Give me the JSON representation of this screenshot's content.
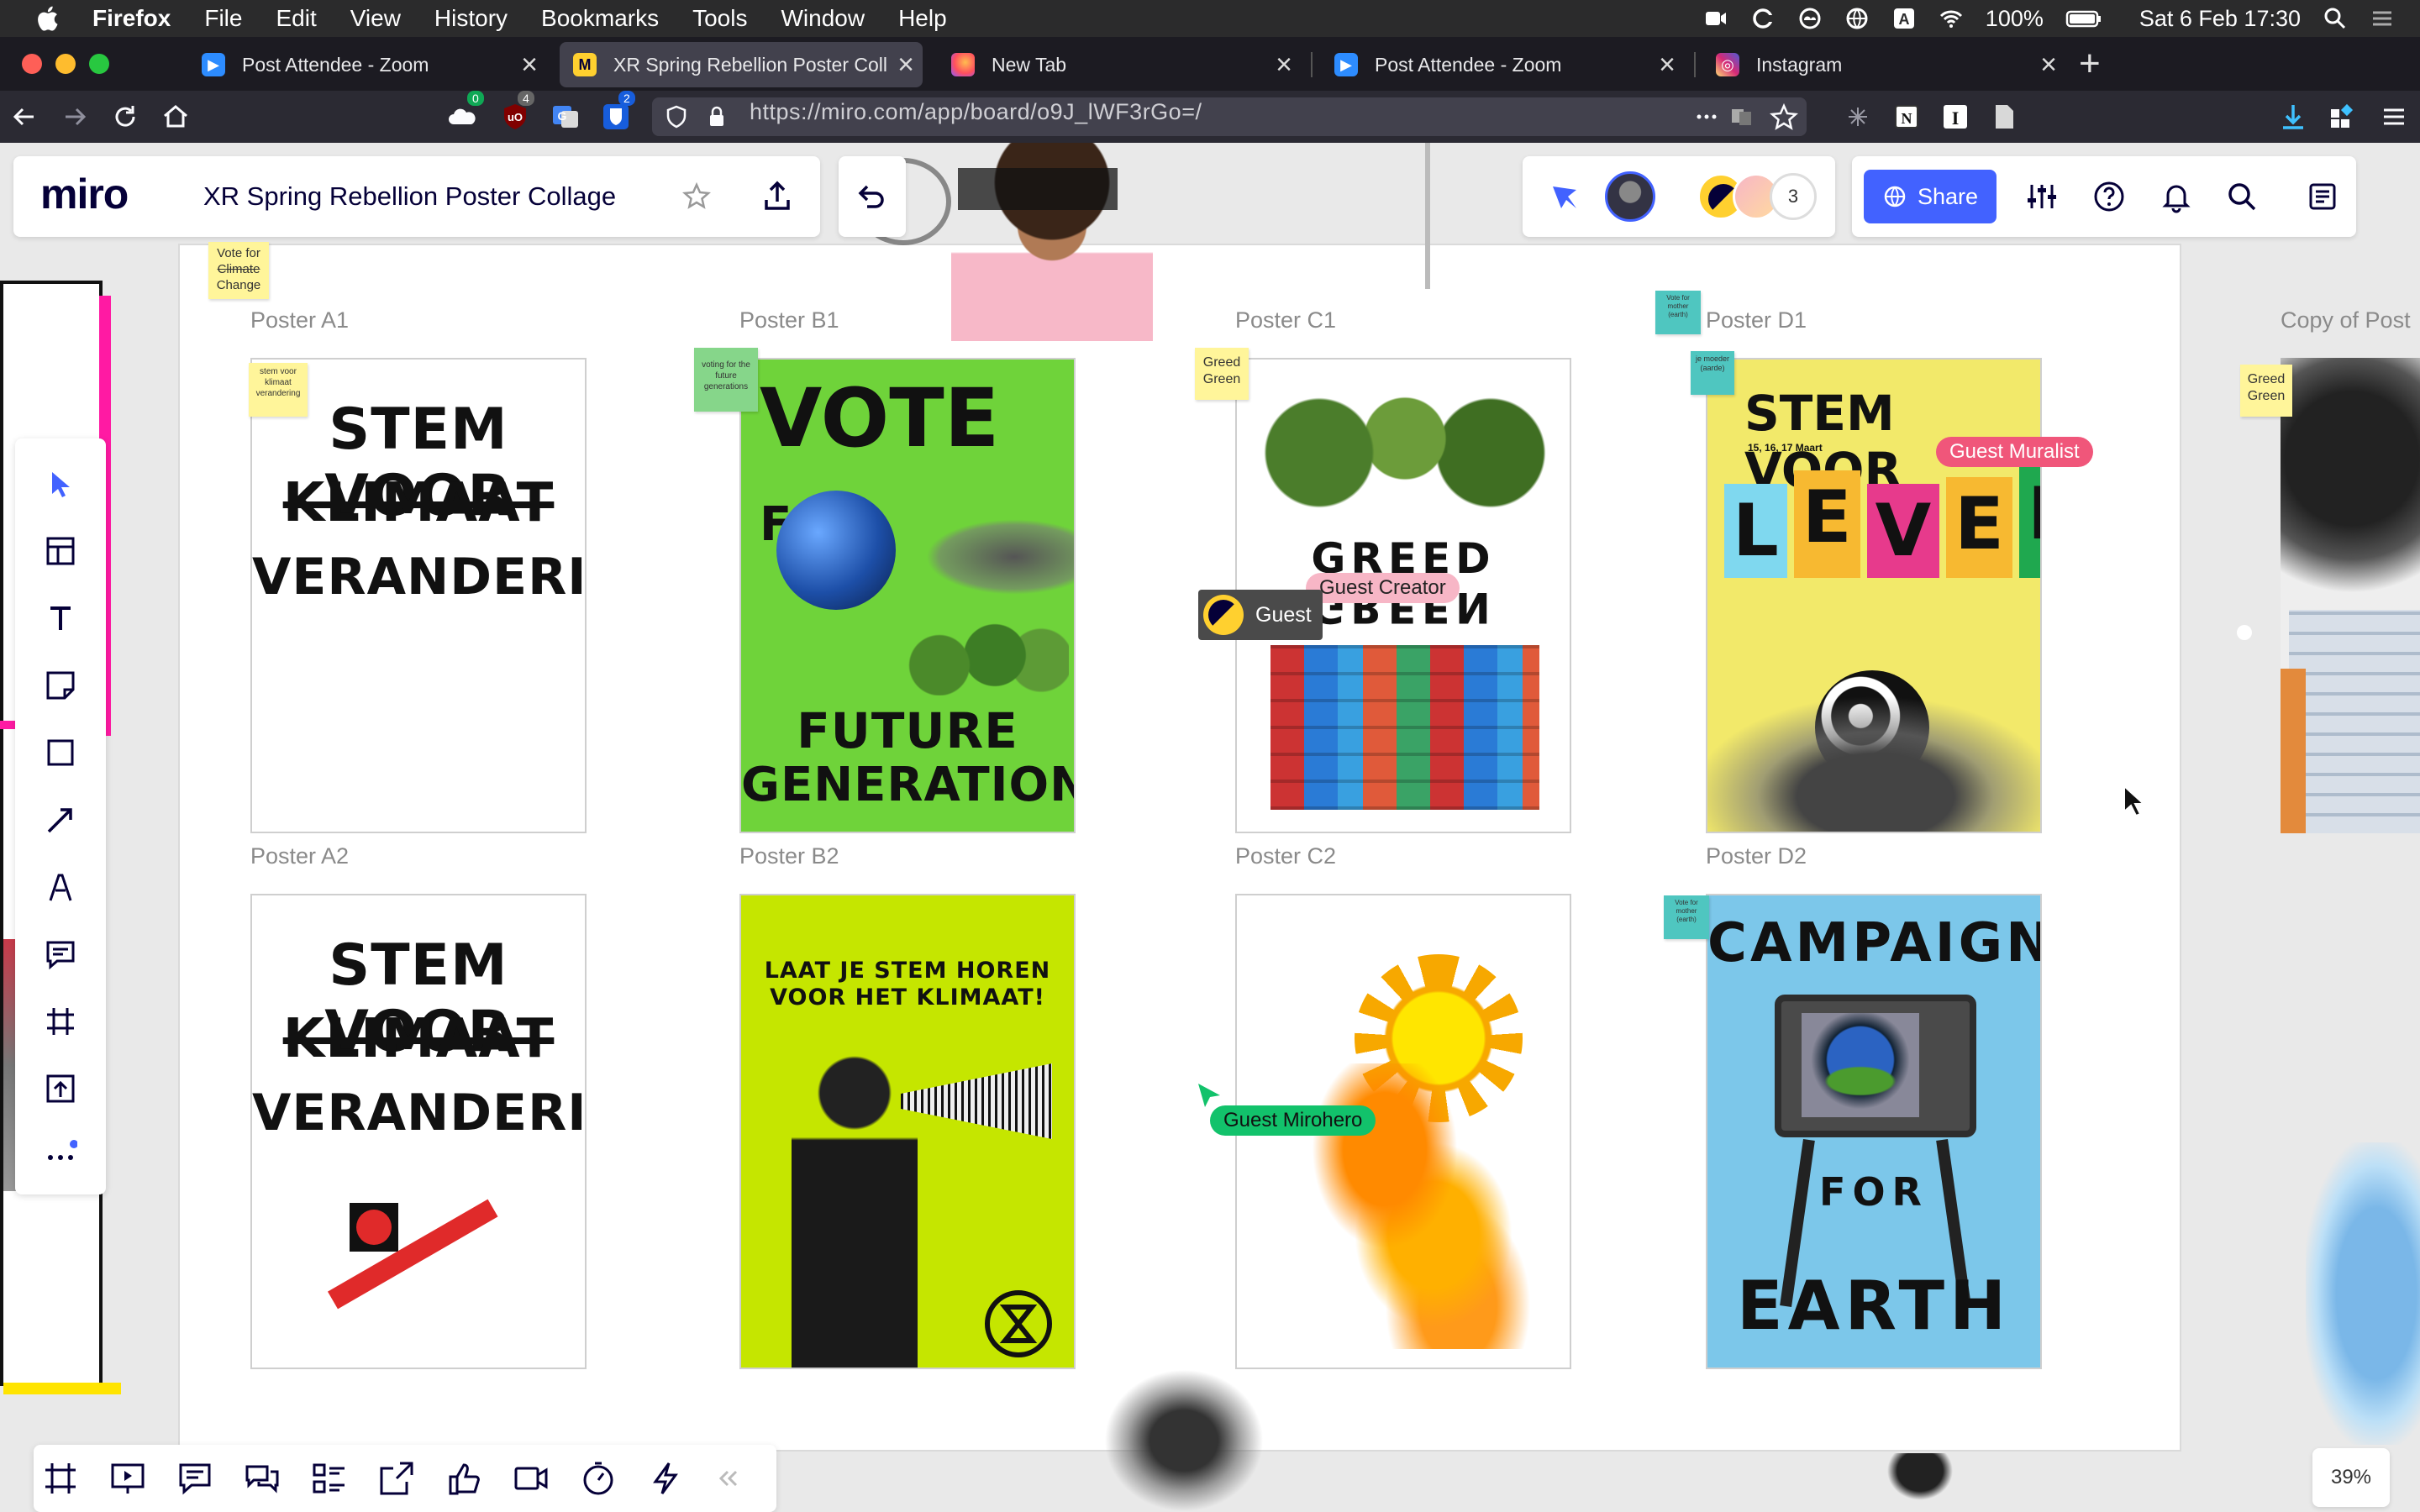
{
  "menubar": {
    "app": "Firefox",
    "items": [
      "File",
      "Edit",
      "View",
      "History",
      "Bookmarks",
      "Tools",
      "Window",
      "Help"
    ],
    "battery": "100%",
    "datetime": "Sat 6 Feb  17:30"
  },
  "tabs": [
    {
      "title": "Post Attendee - Zoom",
      "icon": "zoom-icon",
      "active": false
    },
    {
      "title": "XR Spring Rebellion Poster Coll",
      "icon": "miro-icon",
      "active": true
    },
    {
      "title": "New Tab",
      "icon": "firefox-icon",
      "active": false
    },
    {
      "title": "Post Attendee - Zoom",
      "icon": "zoom-icon",
      "active": false
    },
    {
      "title": "Instagram",
      "icon": "instagram-icon",
      "active": false
    }
  ],
  "navbar": {
    "url": "https://miro.com/app/board/o9J_lWF3rGo=/",
    "badges": [
      "0",
      "4",
      "2"
    ]
  },
  "miro": {
    "logo": "miro",
    "board_title": "XR Spring Rebellion Poster Collage",
    "share_label": "Share",
    "collaborator_count": "3",
    "zoom": "39%",
    "copy_label": "Copy of Post"
  },
  "posters": {
    "a1": {
      "label": "Poster A1",
      "line1": "STEM VOOR",
      "line2": "KLIMAAT",
      "line3": "VERANDERING"
    },
    "b1": {
      "label": "Poster B1",
      "line1": "VOTE",
      "line1b": "FOR",
      "line2": "FUTURE",
      "line3": "GENERATIONS"
    },
    "c1": {
      "label": "Poster C1",
      "line1": "GREED",
      "line2": "GREEN"
    },
    "d1": {
      "label": "Poster D1",
      "line1": "STEM VOOR",
      "sub": "15, 16, 17 Maart",
      "letters": [
        "L",
        "E",
        "V",
        "E",
        "N"
      ]
    },
    "a2": {
      "label": "Poster A2",
      "line1": "STEM VOOR",
      "line2": "KLIMAAT",
      "line3": "VERANDERING"
    },
    "b2": {
      "label": "Poster B2",
      "line1": "LAAT JE STEM HOREN",
      "line2": "VOOR HET KLIMAAT!"
    },
    "c2": {
      "label": "Poster C2"
    },
    "d2": {
      "label": "Poster D2",
      "line1": "CAMPAIGN",
      "line2": "FOR",
      "line3": "EARTH"
    }
  },
  "stickies": {
    "frame": {
      "line1": "Vote for",
      "line2": "Climate",
      "line3": "Change"
    },
    "a1": "stem voor klimaat verandering",
    "b1": "voting for the future generations",
    "c1": "Greed Green",
    "d1_top": "Vote for mother (earth)",
    "d1": "je moeder (aarde)",
    "d2": "Vote for mother (earth)",
    "right": "Greed Green"
  },
  "cursors": {
    "muralist": "Guest Muralist",
    "creator": "Guest Creator",
    "guest": "Guest",
    "mirohero": "Guest Mirohero"
  },
  "colors": {
    "miro_blue": "#4262ff",
    "green_poster": "#6fd33a",
    "lime_poster": "#c5e600",
    "yellow_poster": "#f2e96a",
    "sky_poster": "#7cc7ea",
    "muralist": "#f0567a",
    "creator": "#f7b6c6",
    "mirohero": "#12c26b"
  }
}
